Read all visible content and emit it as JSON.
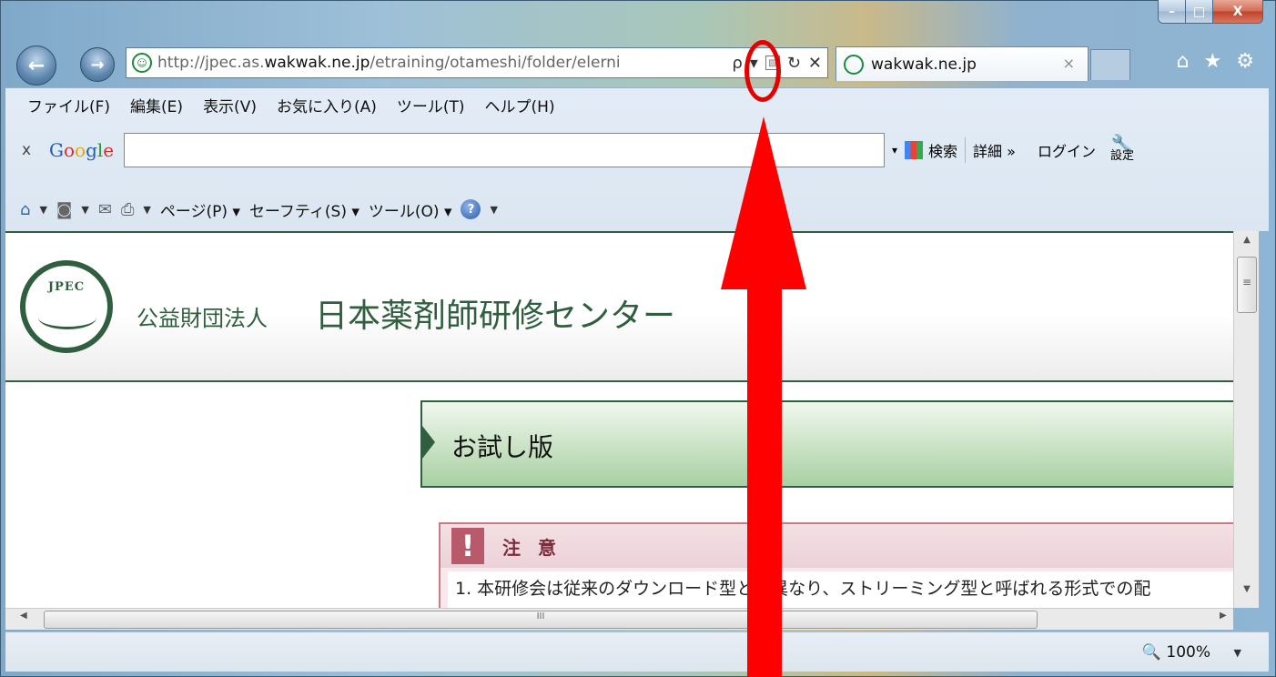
{
  "browser": {
    "address": {
      "url_prefix": "http://jpec.as.",
      "url_host": "wakwak.ne.jp",
      "url_rest": "/etraining/otameshi/folder/elerni"
    },
    "tab": {
      "title": "wakwak.ne.jp",
      "close": "×"
    },
    "addr_tools": {
      "search": "ρ",
      "dropdown": "▾",
      "compat": "▧",
      "refresh": "↻",
      "stop": "✕"
    },
    "caption": {
      "min": "–",
      "max": "□",
      "close": "X"
    },
    "right_icons": {
      "home": "⌂",
      "favorites": "★",
      "tools": "⚙"
    },
    "nav": {
      "back": "←",
      "forward": "→"
    }
  },
  "menubar": [
    "ファイル(F)",
    "編集(E)",
    "表示(V)",
    "お気に入り(A)",
    "ツール(T)",
    "ヘルプ(H)"
  ],
  "googlebar": {
    "close": "x",
    "logo": {
      "G": "G",
      "o1": "o",
      "o2": "o",
      "g": "g",
      "l": "l",
      "e": "e"
    },
    "dropdown": "▾",
    "search_label": "検索",
    "more_label": "詳細 »",
    "login_label": "ログイン",
    "settings_label": "設定"
  },
  "cmdbar": {
    "page": "ページ(P) ▾",
    "safety": "セーフティ(S) ▾",
    "tools": "ツール(O) ▾"
  },
  "page": {
    "logo_text": "JPEC",
    "org_small": "公益財団法人",
    "org_big": "日本薬剤師研修センター",
    "banner_title": "お試し版",
    "notice": {
      "mark": "!",
      "title": "注 意",
      "body": "1. 本研修会は従来のダウンロード型とは異なり、ストリーミング型と呼ばれる形式での配"
    }
  },
  "scrollbars": {
    "up": "▲",
    "down": "▼",
    "left": "◀",
    "right": "▶",
    "grip": "III",
    "vgrip": "≡"
  },
  "status": {
    "zoom": "🔍 100%",
    "zoom_drop": "▼"
  },
  "colors": {
    "annotation": "#ff0000",
    "brand_green": "#2f5f3e",
    "notice_pink": "#b8596c"
  }
}
